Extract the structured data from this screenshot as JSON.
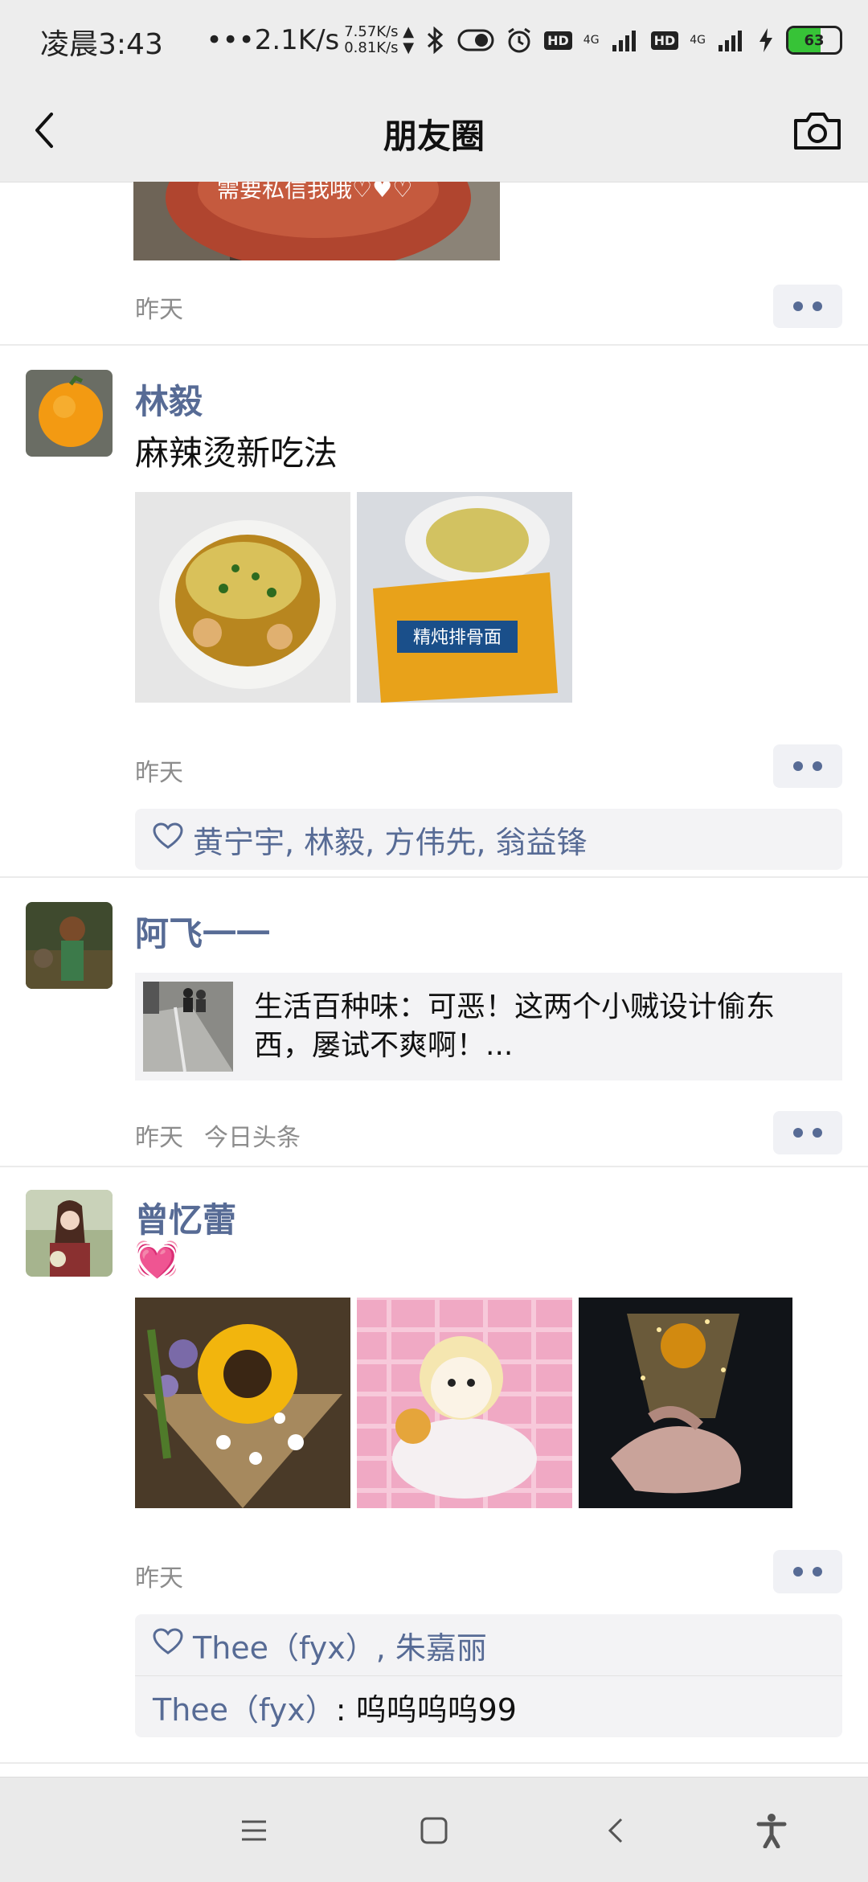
{
  "status_bar": {
    "time": "凌晨3:43",
    "speed_main": "•••2.1K/s",
    "speed_up": "7.57K/s ▲",
    "speed_down": "0.81K/s ▼",
    "hd1": "HD",
    "net1": "4G",
    "hd2": "HD",
    "net2": "4G",
    "battery": "63",
    "battery_level": 0.63,
    "battery_color": "#37c337"
  },
  "header": {
    "title": "朋友圈",
    "back_icon": "back-arrow-icon",
    "camera_icon": "camera-icon"
  },
  "posts": [
    {
      "overlay_text": "需要私信我哦♡♥♡",
      "time": "昨天"
    },
    {
      "name": "林毅",
      "text": "麻辣烫新吃法",
      "time": "昨天",
      "likes": "黄宁宇, 林毅, 方伟先, 翁益锋"
    },
    {
      "name": "阿飞一一",
      "link_title": "生活百种味：可恶！这两个小贼设计偷东西，屡试不爽啊！...",
      "time": "昨天",
      "source": "今日头条"
    },
    {
      "name": "曾忆蕾",
      "emoji": "💓",
      "time": "昨天",
      "likes": "Thee（fyx）, 朱嘉丽",
      "comment_name": "Thee（fyx）",
      "comment_text": ": 呜呜呜呜99"
    }
  ],
  "colors": {
    "link_blue": "#576b95",
    "header_bg": "#ededed",
    "time_gray": "#8c8c8c"
  }
}
